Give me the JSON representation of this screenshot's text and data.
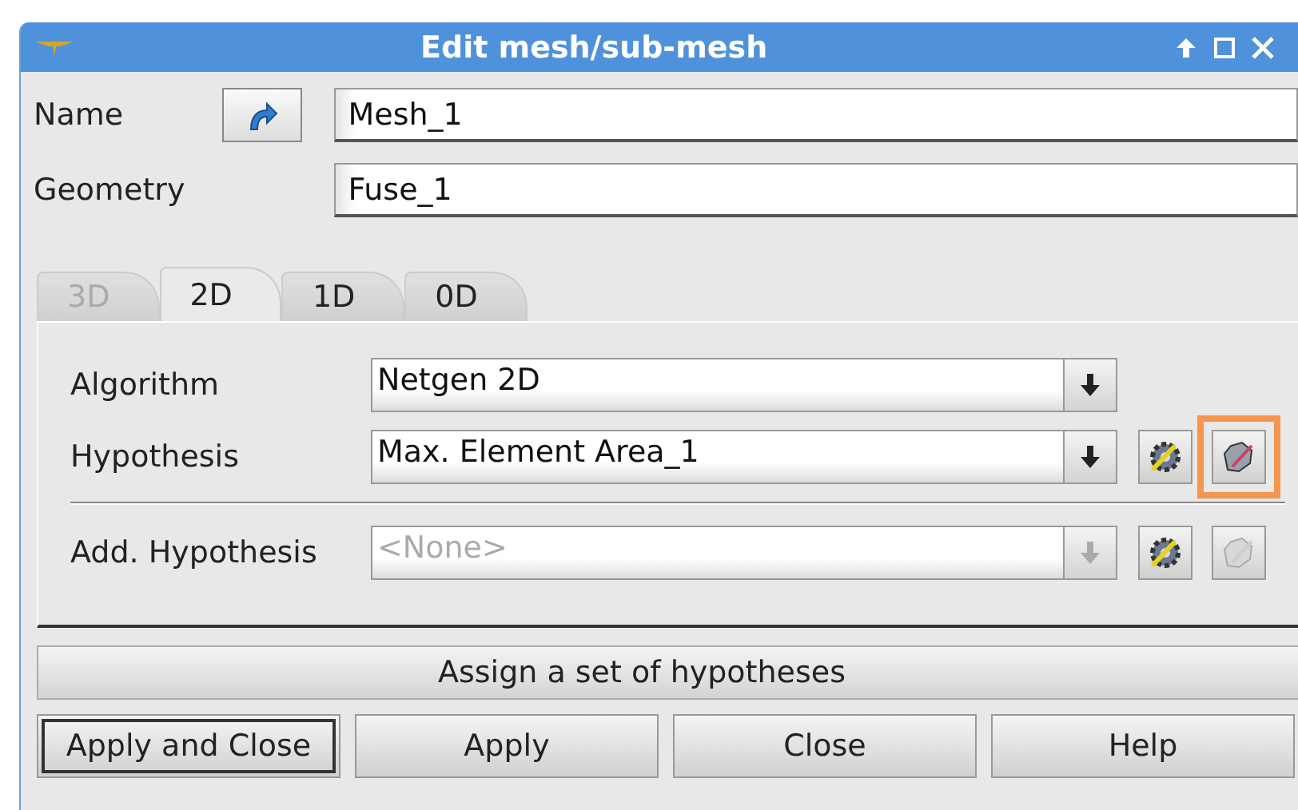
{
  "window": {
    "title": "Edit mesh/sub-mesh"
  },
  "fields": [
    {
      "label": "Name",
      "value": "Mesh_1",
      "kind": "selectable"
    },
    {
      "label": "Geometry",
      "value": "Fuse_1",
      "kind": "plain"
    }
  ],
  "tabs": [
    {
      "label": "3D",
      "selected": false,
      "disabled": true
    },
    {
      "label": "2D",
      "selected": true,
      "disabled": false
    },
    {
      "label": "1D",
      "selected": false,
      "disabled": false
    },
    {
      "label": "0D",
      "selected": false,
      "disabled": false
    }
  ],
  "rows": [
    {
      "kind": "algorithm",
      "label": "Algorithm",
      "value": "Netgen 2D",
      "disabled": false
    },
    {
      "kind": "hypothesis",
      "label": "Hypothesis",
      "value": "Max. Element Area_1",
      "disabled": false,
      "edit_disabled": false,
      "highlighted": true,
      "separator_before": false
    },
    {
      "kind": "hypothesis",
      "label": "Add. Hypothesis",
      "value": "<None>",
      "disabled": true,
      "edit_disabled": true,
      "highlighted": false,
      "separator_before": true
    }
  ],
  "assign_button": "Assign a set of hypotheses",
  "buttons": [
    {
      "label": "Apply and Close",
      "default": true
    },
    {
      "label": "Apply",
      "default": false
    },
    {
      "label": "Close",
      "default": false
    },
    {
      "label": "Help",
      "default": false
    }
  ]
}
